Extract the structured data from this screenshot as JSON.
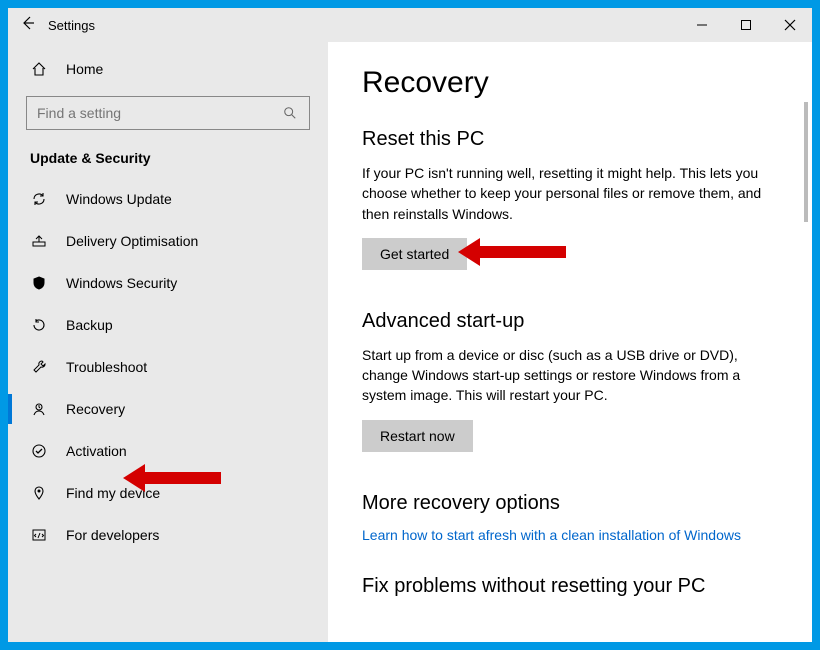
{
  "titlebar": {
    "title": "Settings"
  },
  "sidebar": {
    "home": "Home",
    "search_placeholder": "Find a setting",
    "category": "Update & Security",
    "items": [
      {
        "label": "Windows Update"
      },
      {
        "label": "Delivery Optimisation"
      },
      {
        "label": "Windows Security"
      },
      {
        "label": "Backup"
      },
      {
        "label": "Troubleshoot"
      },
      {
        "label": "Recovery"
      },
      {
        "label": "Activation"
      },
      {
        "label": "Find my device"
      },
      {
        "label": "For developers"
      }
    ]
  },
  "main": {
    "heading": "Recovery",
    "reset": {
      "title": "Reset this PC",
      "desc": "If your PC isn't running well, resetting it might help. This lets you choose whether to keep your personal files or remove them, and then reinstalls Windows.",
      "button": "Get started"
    },
    "advanced": {
      "title": "Advanced start-up",
      "desc": "Start up from a device or disc (such as a USB drive or DVD), change Windows start-up settings or restore Windows from a system image. This will restart your PC.",
      "button": "Restart now"
    },
    "more": {
      "title": "More recovery options",
      "link": "Learn how to start afresh with a clean installation of Windows"
    },
    "fix": {
      "title": "Fix problems without resetting your PC"
    }
  }
}
